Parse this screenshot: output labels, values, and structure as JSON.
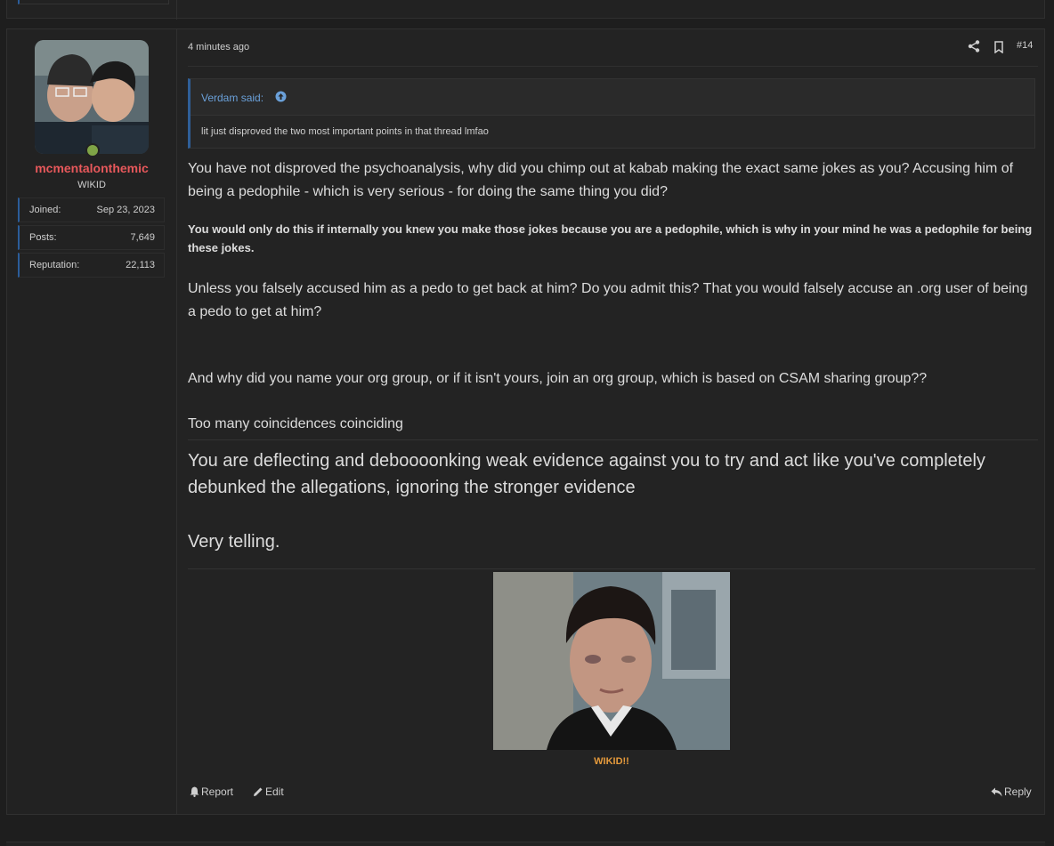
{
  "post": {
    "timestamp": "4 minutes ago",
    "post_number": "#14",
    "user": {
      "username": "mcmentalonthemic",
      "title": "WIKID",
      "stats": [
        {
          "label": "Joined:",
          "value": "Sep 23, 2023"
        },
        {
          "label": "Posts:",
          "value": "7,649"
        },
        {
          "label": "Reputation:",
          "value": "22,113"
        }
      ]
    },
    "quote": {
      "author": "Verdam said:",
      "text": "lit just disproved the two most important points in that thread lmfao"
    },
    "body": [
      "You have not disproved the psychoanalysis, why did you chimp out at kabab making the exact same jokes as you? Accusing him of being a pedophile - which is very serious - for doing the same thing you did?",
      "You would only do this if internally you knew you make those jokes because you are a pedophile, which is why in your mind he was a pedophile for being these jokes.",
      "Unless you falsely accused him as a pedo to get back at him? Do you admit this? That you would falsely accuse an .org user of being a pedo to get at him?",
      "And why did you name your org group, or if it isn't yours, join an org group, which is based on CSAM sharing group??",
      "Too many coincidences coinciding",
      "You are deflecting and deboooonking weak evidence against you to try and act like you've completely debunked the allegations, ignoring the stronger evidence",
      "Very telling."
    ],
    "signature": {
      "caption": "WIKID!!"
    },
    "actions": {
      "report": "Report",
      "edit": "Edit",
      "reply": "Reply"
    }
  },
  "colors": {
    "background": "#1e1e1e",
    "username": "#e7585b",
    "quote_link": "#6aa0d9",
    "quote_border": "#2f5f98",
    "signature_caption": "#e59a3c",
    "online": "#7fa446"
  },
  "icons": [
    "share-icon",
    "bookmark-icon",
    "arrow-up-circle-icon",
    "bell-icon",
    "pencil-icon",
    "reply-icon"
  ]
}
